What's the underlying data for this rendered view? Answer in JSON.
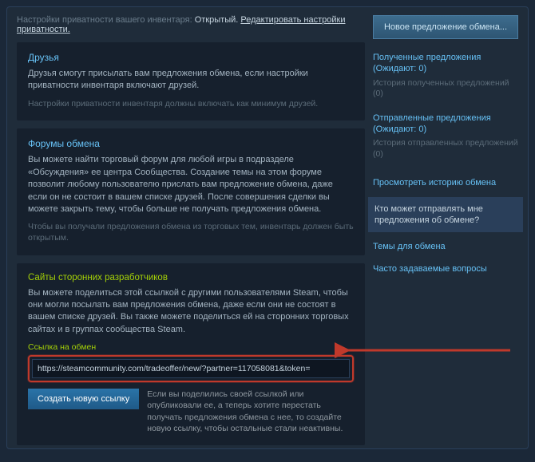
{
  "header": {
    "prefix": "Настройки приватности вашего инвентаря: ",
    "status": "Открытый. ",
    "edit_link": "Редактировать настройки приватности."
  },
  "panels": {
    "friends": {
      "title": "Друзья",
      "body": "Друзья смогут присылать вам предложения обмена, если настройки приватности инвентаря включают друзей.",
      "hint": "Настройки приватности инвентаря должны включать как минимум друзей."
    },
    "forums": {
      "title": "Форумы обмена",
      "body": "Вы можете найти торговый форум для любой игры в подразделе «Обсуждения» ее центра Сообщества. Создание темы на этом форуме позволит любому пользователю прислать вам предложение обмена, даже если он не состоит в вашем списке друзей. После совершения сделки вы можете закрыть тему, чтобы больше не получать предложения обмена.",
      "hint": "Чтобы вы получали предложения обмена из торговых тем, инвентарь должен быть открытым."
    },
    "third": {
      "title": "Сайты сторонних разработчиков",
      "body": "Вы можете поделиться этой ссылкой с другими пользователями Steam, чтобы они могли посылать вам предложения обмена, даже если они не состоят в вашем списке друзей. Вы также можете поделиться ей на сторонних торговых сайтах и в группах сообщества Steam.",
      "url_label": "Ссылка на обмен",
      "url_value": "https://steamcommunity.com/tradeoffer/new/?partner=117058081&token=",
      "new_url_btn": "Создать новую ссылку",
      "new_url_desc": "Если вы поделились своей ссылкой или опубликовали ее, а теперь хотите перестать получать предложения обмена с нее, то создайте новую ссылку, чтобы остальные стали неактивны."
    }
  },
  "sidebar": {
    "new_offer": "Новое предложение обмена...",
    "received": {
      "title": "Полученные предложения",
      "wait": "(Ожидают: 0)",
      "history": "История полученных предложений (0)"
    },
    "sent": {
      "title": "Отправленные предложения",
      "wait": "(Ожидают: 0)",
      "history": "История отправленных предложений (0)"
    },
    "history": "Просмотреть историю обмена",
    "who": "Кто может отправлять мне предложения об обмене?",
    "topics": "Темы для обмена",
    "faq": "Часто задаваемые вопросы"
  }
}
